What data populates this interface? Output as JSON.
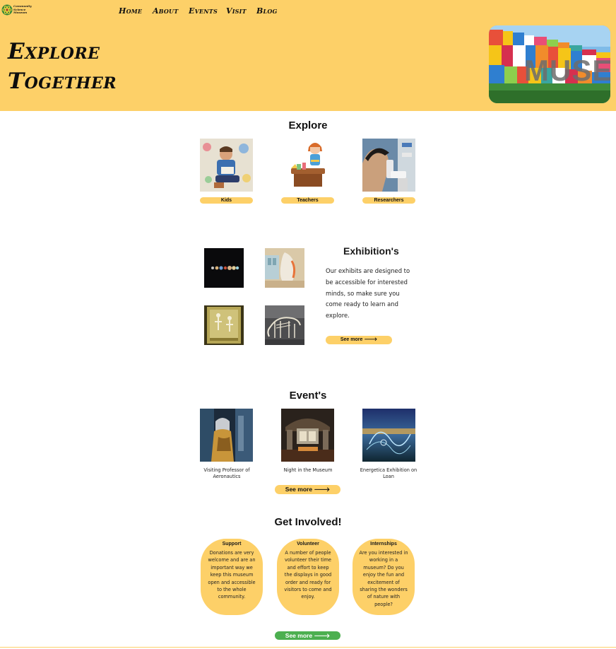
{
  "logo": {
    "text": [
      "Community",
      "Science",
      "Museum"
    ],
    "icon": "atom-logo-icon"
  },
  "nav": {
    "items": [
      "Home",
      "About",
      "Events",
      "Visit",
      "Blog"
    ]
  },
  "hero": {
    "title_line1": "Explore",
    "title_line2": "Together",
    "image": "museum-building-photo"
  },
  "explore": {
    "title": "Explore",
    "cards": [
      {
        "label": "Kids",
        "image": "kid-reading-photo"
      },
      {
        "label": "Teachers",
        "image": "teacher-cartoon"
      },
      {
        "label": "Researchers",
        "image": "researcher-microscope-photo"
      }
    ]
  },
  "exhibitions": {
    "title": "Exhibition's",
    "text": "Our exhibits are designed to be accessible for interested minds, so make sure you come ready to learn and explore.",
    "button": "See more 🡒",
    "images": [
      "planets-exhibit",
      "glass-sculpture-exhibit",
      "skeleton-display-case",
      "mammoth-skeleton"
    ]
  },
  "events": {
    "title": "Event's",
    "items": [
      {
        "caption": "Visiting Professor of Aeronautics",
        "image": "professor-event-photo"
      },
      {
        "caption": "Night in the Museum",
        "image": "museum-hall-night-photo"
      },
      {
        "caption": "Energetica Exhibition on Loan",
        "image": "energy-light-photo"
      }
    ],
    "button": "See more 🡒"
  },
  "involved": {
    "title": "Get Involved!",
    "cards": [
      {
        "heading": "Support",
        "text": "Donations are very welcome and are an important way we keep this museum open and accessible to the whole community."
      },
      {
        "heading": "Volunteer",
        "text": "A number of people volunteer their time and effort to keep the displays in good order and ready for visitors to come and enjoy."
      },
      {
        "heading": "Internships",
        "text": "Are you interested in working in a museum? Do you enjoy the fun and excitement of sharing the wonders of nature with people?"
      }
    ],
    "button": "See more 🡒"
  },
  "colors": {
    "accent": "#fdd068",
    "green": "#4caf50"
  }
}
